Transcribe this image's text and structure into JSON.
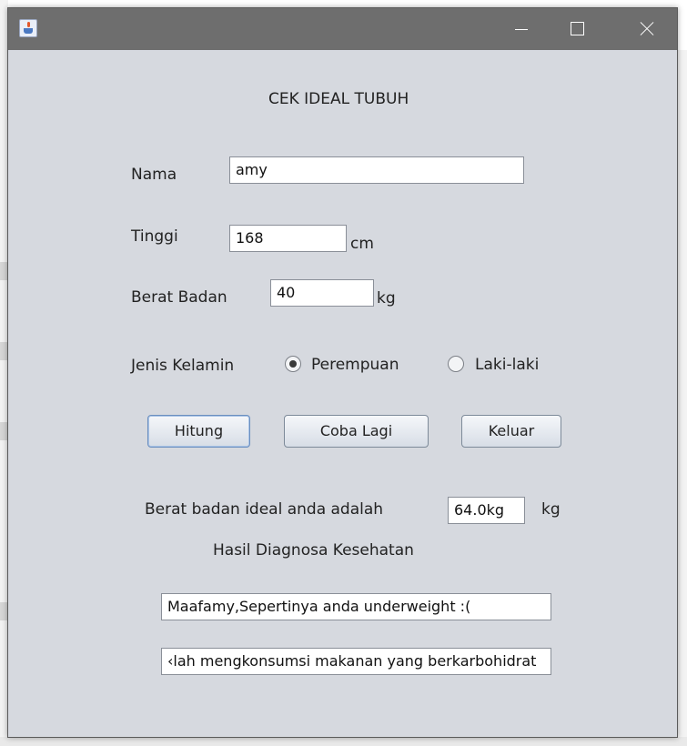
{
  "window": {
    "title": "",
    "app_icon": "java-cup-icon",
    "controls": {
      "minimize": "minimize-icon",
      "maximize": "maximize-icon",
      "close": "close-icon"
    }
  },
  "form": {
    "heading": "CEK IDEAL TUBUH",
    "nama": {
      "label": "Nama",
      "value": "amy"
    },
    "tinggi": {
      "label": "Tinggi",
      "value": "168",
      "unit": "cm"
    },
    "berat": {
      "label": "Berat Badan",
      "value": "40",
      "unit": "kg"
    },
    "gender": {
      "label": "Jenis Kelamin",
      "options": [
        "Perempuan",
        "Laki-laki"
      ],
      "selected": "Perempuan"
    },
    "buttons": {
      "hitung": "Hitung",
      "coba_lagi": "Coba Lagi",
      "keluar": "Keluar"
    },
    "result": {
      "label": "Berat badan ideal anda adalah",
      "value": "64.0kg",
      "unit": "kg"
    },
    "diagnosis": {
      "heading": "Hasil Diagnosa Kesehatan",
      "line1": "Maafamy,Sepertinya anda underweight :(",
      "line2": "‹lah mengkonsumsi makanan yang berkarbohidrat"
    }
  },
  "colors": {
    "window_bg": "#d6d9df",
    "titlebar": "#6e6e6e",
    "field_border": "#8a8f98"
  }
}
